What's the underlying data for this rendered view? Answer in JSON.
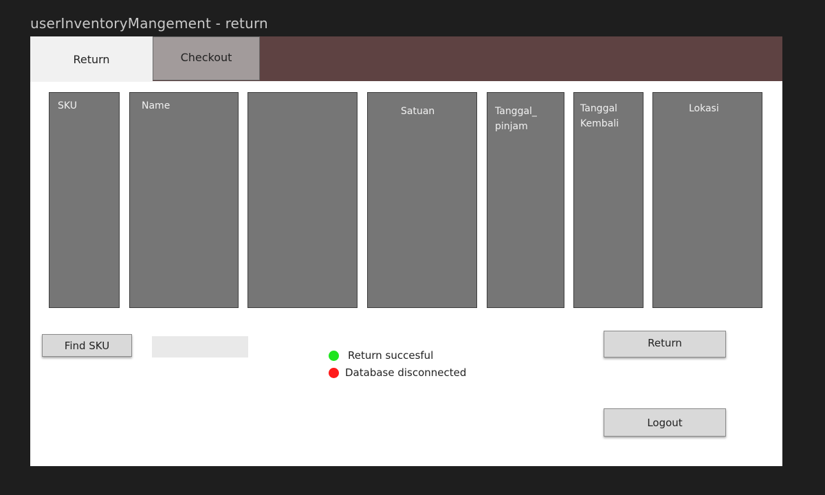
{
  "window": {
    "title": "userInventoryMangement - return"
  },
  "tabs": [
    {
      "label": "Return",
      "active": true
    },
    {
      "label": "Checkout",
      "active": false
    }
  ],
  "table": {
    "columns": [
      {
        "line1": "SKU",
        "line2": ""
      },
      {
        "line1": "Name",
        "line2": ""
      },
      {
        "line1": "",
        "line2": ""
      },
      {
        "line1": "Satuan",
        "line2": ""
      },
      {
        "line1": "Tanggal_",
        "line2": "pinjam"
      },
      {
        "line1": "Tanggal",
        "line2": "Kembali"
      },
      {
        "line1": "Lokasi",
        "line2": ""
      }
    ]
  },
  "controls": {
    "find_sku_label": "Find SKU",
    "sku_input_value": "",
    "sku_input_placeholder": "",
    "return_label": "Return",
    "logout_label": "Logout"
  },
  "status": {
    "success_text": "Return succesful",
    "error_text": "Database disconnected"
  },
  "colors": {
    "success_dot": "#1fe51f",
    "error_dot": "#ff1a1a",
    "tabbar_bg": "#5e4242",
    "column_bg": "#767676"
  }
}
